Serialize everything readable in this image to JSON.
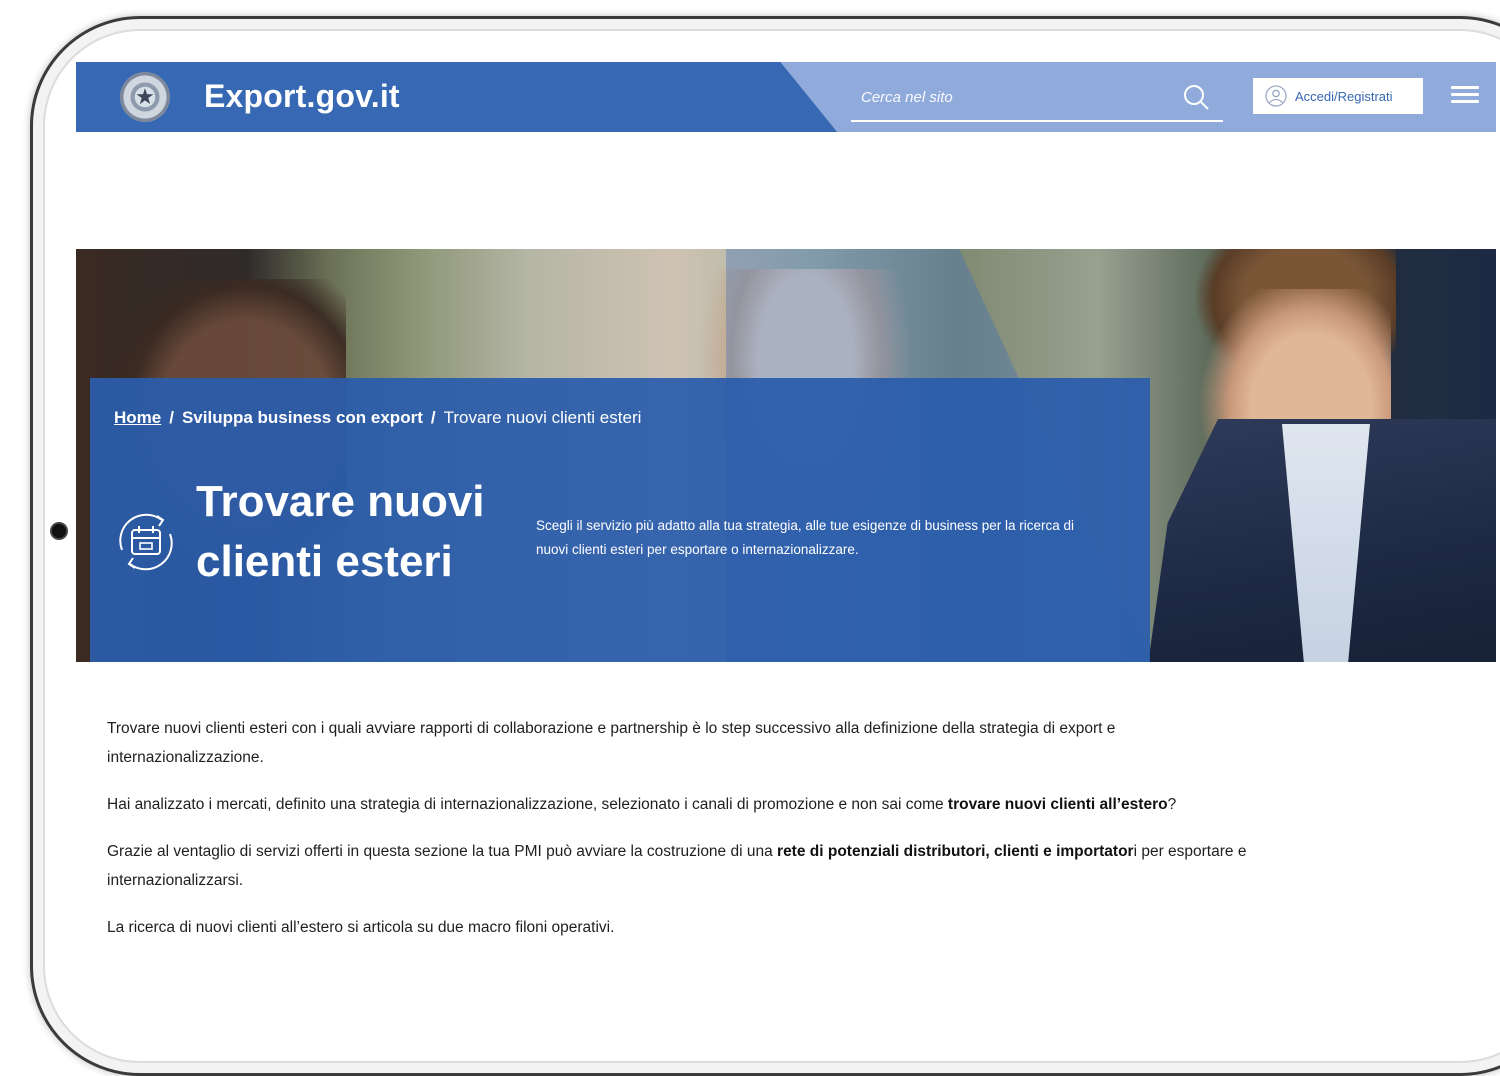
{
  "header": {
    "site_title": "Export.gov.it",
    "search_placeholder": "Cerca nel sito",
    "login_label": "Accedi/Registrati",
    "colors": {
      "primary": "#3668b3",
      "secondary": "#8faadb"
    }
  },
  "breadcrumb": {
    "home": "Home",
    "separator": "/",
    "section": "Sviluppa business con export",
    "current": "Trovare nuovi clienti esteri"
  },
  "hero": {
    "title": "Trovare nuovi clienti esteri",
    "description": "Scegli il servizio più adatto alla tua strategia, alle tue esigenze di business per la ricerca di nuovi clienti esteri per esportare o internazionalizzare."
  },
  "content": {
    "p1": "Trovare nuovi clienti esteri con i quali avviare rapporti di collaborazione e partnership è lo step successivo alla definizione della strategia di export e internazionalizzazione.",
    "p2_before": "Hai analizzato i mercati, definito una strategia di internazionalizzazione, selezionato i canali di promozione e non sai come ",
    "p2_bold": "trovare nuovi clienti all’estero",
    "p2_after": "?",
    "p3_before": "Grazie al ventaglio di servizi offerti in questa sezione la tua PMI può avviare la costruzione di una ",
    "p3_bold": "rete di potenziali distributori, clienti e importator",
    "p3_after": "i per esportare e internazionalizzarsi.",
    "p4": "La ricerca di nuovi clienti all’estero si articola su due macro filoni operativi."
  }
}
